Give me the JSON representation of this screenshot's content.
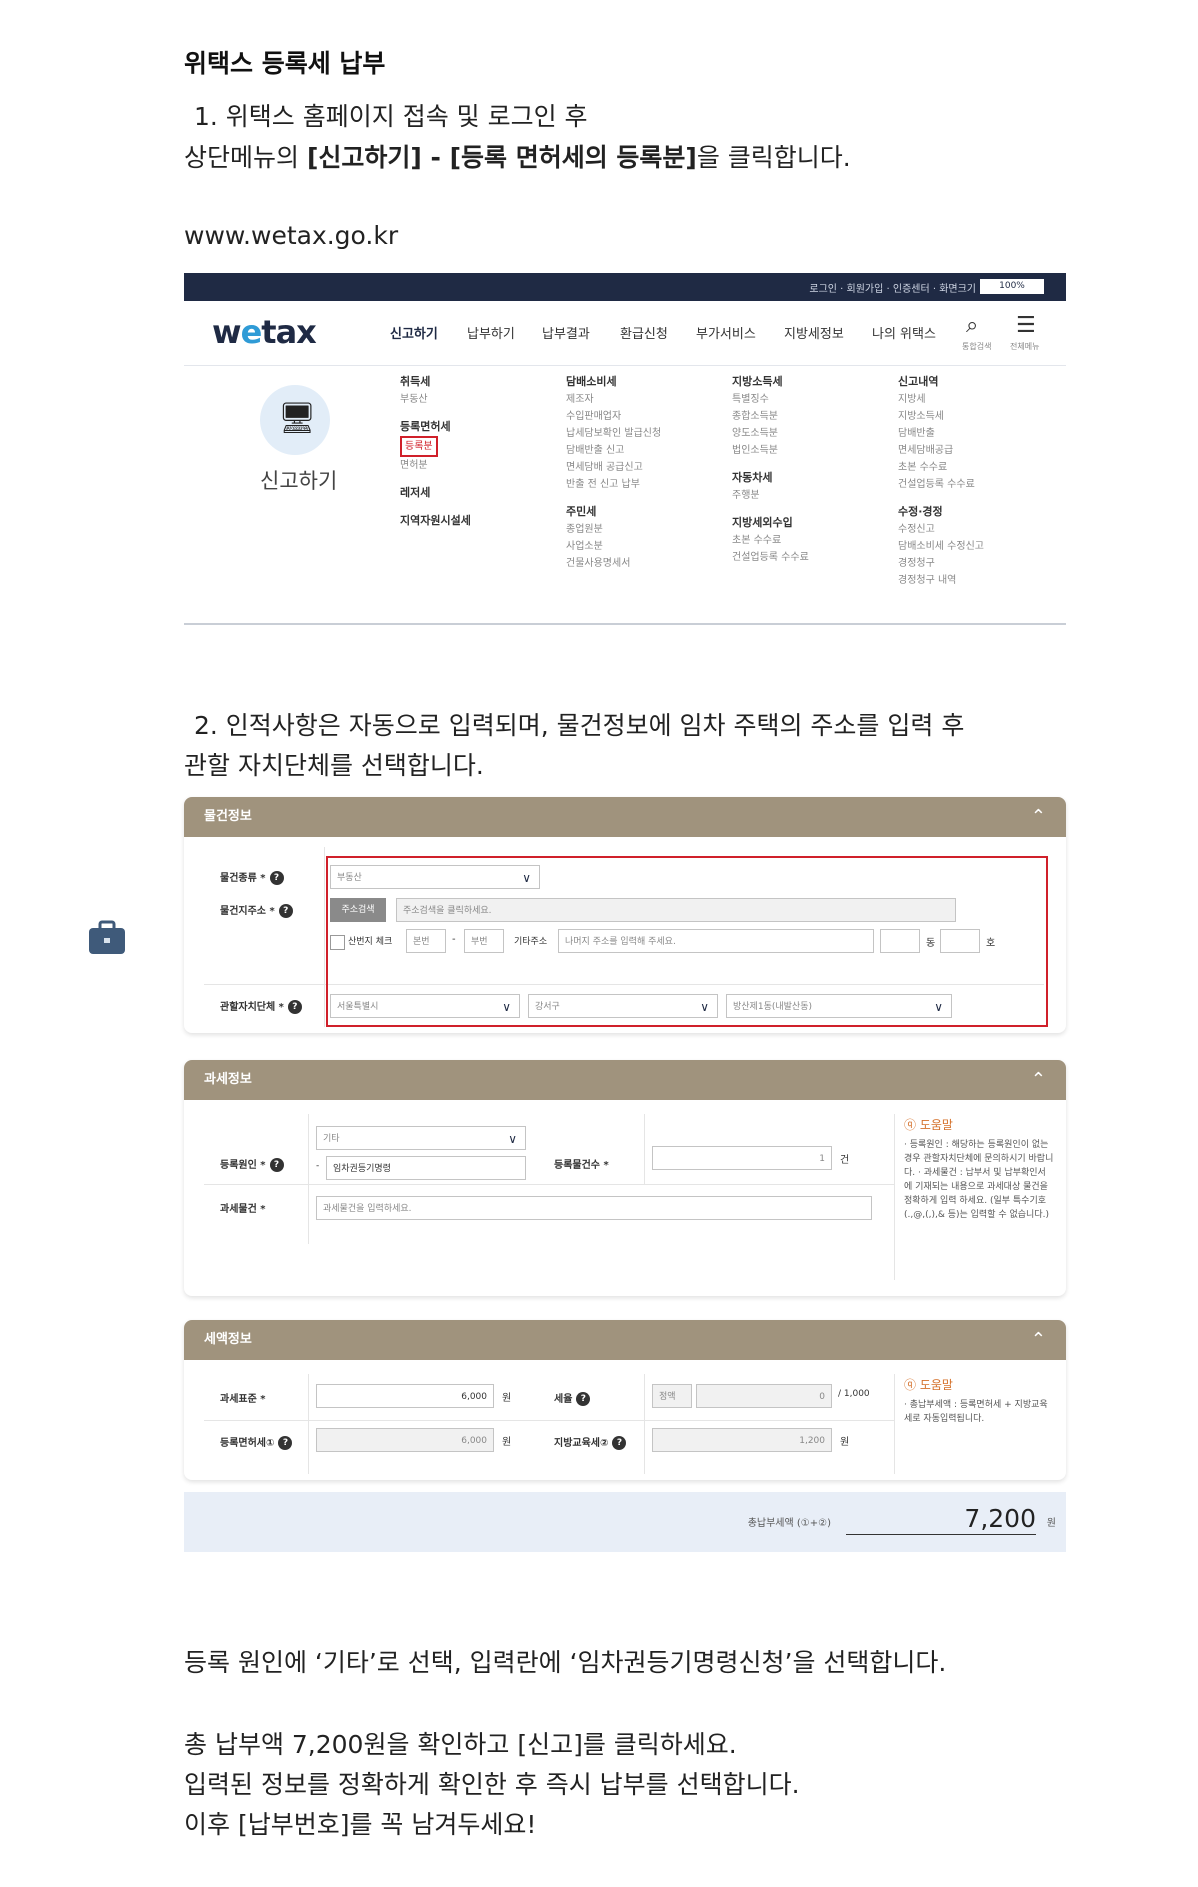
{
  "heading": "위택스 등록세 납부",
  "step1": {
    "line1": "1. 위택스 홈페이지 접속 및 로그인 후",
    "line2_prefix": "상단메뉴의 ",
    "line2_bold": "[신고하기] - [등록 면허세의 등록분]",
    "line2_suffix": "을 클릭합니다."
  },
  "url": "www.wetax.go.kr",
  "wetax": {
    "top_links": "로그인 · 회원가입 · 인증센터 · 화면크기",
    "zoom": "100%",
    "logo_w": "w",
    "logo_e": "e",
    "logo_rest": "tax",
    "nav": [
      "신고하기",
      "납부하기",
      "납부결과",
      "환급신청",
      "부가서비스",
      "지방세정보",
      "나의 위택스"
    ],
    "search_caption": "통합검색",
    "menu_caption": "전체메뉴",
    "mega_title": "신고하기",
    "col1": {
      "g1": "취득세",
      "g1_items": [
        "부동산"
      ],
      "g2": "등록면허세",
      "g2_highlight": "등록분",
      "g2_items": [
        "면허분"
      ],
      "g3": "레저세",
      "g4": "지역자원시설세"
    },
    "col2": {
      "g1": "담배소비세",
      "g1_items": [
        "제조자",
        "수입판매업자",
        "납세담보확인 발급신청",
        "담배반출 신고",
        "면세담배 공급신고",
        "반출 전 신고 납부"
      ],
      "g2": "주민세",
      "g2_items": [
        "종업원분",
        "사업소분",
        "건물사용명세서"
      ]
    },
    "col3": {
      "g1": "지방소득세",
      "g1_items": [
        "특별징수",
        "종합소득분",
        "양도소득분",
        "법인소득분"
      ],
      "g2": "자동차세",
      "g2_items": [
        "주행분"
      ],
      "g3": "지방세외수입",
      "g3_items": [
        "초본 수수료",
        "건설업등록 수수료"
      ]
    },
    "col4": {
      "g1": "신고내역",
      "g1_items": [
        "지방세",
        "지방소득세",
        "담배반출",
        "면세담배공급",
        "초본 수수료",
        "건설업등록 수수료"
      ],
      "g2": "수정·경정",
      "g2_items": [
        "수정신고",
        "담배소비세 수정신고",
        "경정청구",
        "경정청구 내역"
      ]
    }
  },
  "step2": {
    "line1": "2. 인적사항은 자동으로 입력되며, 물건정보에 임차 주택의 주소를 입력 후",
    "line2": "관할 자치단체를 선택합니다."
  },
  "form": {
    "goods": {
      "title": "물건정보",
      "type_label": "물건종류 *",
      "type_value": "부동산",
      "addr_label": "물건지주소 *",
      "addr_button": "주소검색",
      "addr_placeholder": "주소검색을 클릭하세요.",
      "mountain": "산번지 체크",
      "main_no": "본번",
      "dash": "-",
      "sub_no": "부번",
      "other_addr": "기타주소",
      "other_addr_placeholder": "나머지 주소를 입력해 주세요.",
      "dong": "동",
      "ho": "호",
      "region_label": "관할자치단체 *",
      "region_city": "서울특별시",
      "region_gu": "강서구",
      "region_dong": "방산제1동(내발산동)"
    },
    "tax": {
      "title": "과세정보",
      "cause_label": "등록원인 *",
      "cause_value": "기타",
      "cause_input": "임차권등기명령",
      "count_label": "등록물건수 *",
      "count_value": "1",
      "count_unit": "건",
      "object_label": "과세물건 *",
      "object_placeholder": "과세물건을 입력하세요.",
      "help_title": "도움말",
      "help_text": "· 등록원인 : 해당하는 등록원인이 없는 경우 관할자치단체에 문의하시기 바랍니다. · 과세물건 : 납부서 및 납부확인서에 기재되는 내용으로 과세대상 물건을 정확하게 입력 하세요. (일부 특수기호 (.,@,(,),& 등)는 입력할 수 없습니다.)"
    },
    "amount": {
      "title": "세액정보",
      "base_label": "과세표준 *",
      "base_value": "6,000",
      "won": "원",
      "rate_label": "세율",
      "rate_tag": "정액",
      "rate_value": "0",
      "rate_unit": "/ 1,000",
      "reg_tax_label": "등록면허세①",
      "reg_tax_value": "6,000",
      "edu_tax_label": "지방교육세②",
      "edu_tax_value": "1,200",
      "help_title": "도움말",
      "help_text": "· 총납부세액 : 등록면허세 + 지방교육세로 자동입력됩니다.",
      "total_label": "총납부세액 (①+②)",
      "total_value": "7,200",
      "total_unit": "원"
    }
  },
  "note1": "등록 원인에 ‘기타’로 선택, 입력란에 ‘임차권등기명령신청’을 선택합니다.",
  "note2": "총 납부액 7,200원을 확인하고 [신고]를 클릭하세요.",
  "note3": "입력된 정보를 정확하게 확인한 후 즉시 납부를 선택합니다.",
  "note4": "이후 [납부번호]를 꼭 남겨두세요!"
}
